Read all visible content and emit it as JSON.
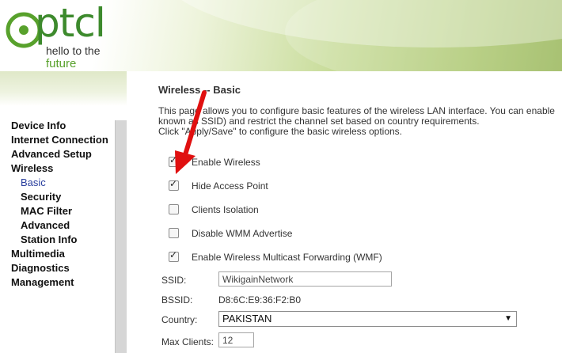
{
  "logo": {
    "word": "ptcl",
    "tagline_1": "hello to the",
    "tagline_2": "future"
  },
  "nav": {
    "items": [
      {
        "label": "Device Info"
      },
      {
        "label": "Internet Connection"
      },
      {
        "label": "Advanced Setup"
      },
      {
        "label": "Wireless"
      },
      {
        "label": "Basic",
        "active": true
      },
      {
        "label": "Security"
      },
      {
        "label": "MAC Filter"
      },
      {
        "label": "Advanced"
      },
      {
        "label": "Station Info"
      },
      {
        "label": "Multimedia"
      },
      {
        "label": "Diagnostics"
      },
      {
        "label": "Management"
      }
    ]
  },
  "page": {
    "title": "Wireless -- Basic",
    "desc_line1": "This page allows you to configure basic features of the wireless LAN interface. You can enable",
    "desc_line2": "known as SSID) and restrict the channel set based on country requirements.",
    "desc_line3": "Click \"Apply/Save\" to configure the basic wireless options."
  },
  "options": [
    {
      "label": "Enable Wireless",
      "checked": true
    },
    {
      "label": "Hide Access Point",
      "checked": true
    },
    {
      "label": "Clients Isolation",
      "checked": false
    },
    {
      "label": "Disable WMM Advertise",
      "checked": false
    },
    {
      "label": "Enable Wireless Multicast Forwarding (WMF)",
      "checked": true
    }
  ],
  "fields": {
    "ssid_label": "SSID:",
    "ssid_value": "WikigainNetwork",
    "bssid_label": "BSSID:",
    "bssid_value": "D8:6C:E9:36:F2:B0",
    "country_label": "Country:",
    "country_value": "PAKISTAN",
    "max_clients_label": "Max Clients:",
    "max_clients_value": "12"
  },
  "colors": {
    "brand_green": "#3d8a2d",
    "active_nav": "#2a3f9e",
    "annotation_arrow": "#e01010"
  }
}
